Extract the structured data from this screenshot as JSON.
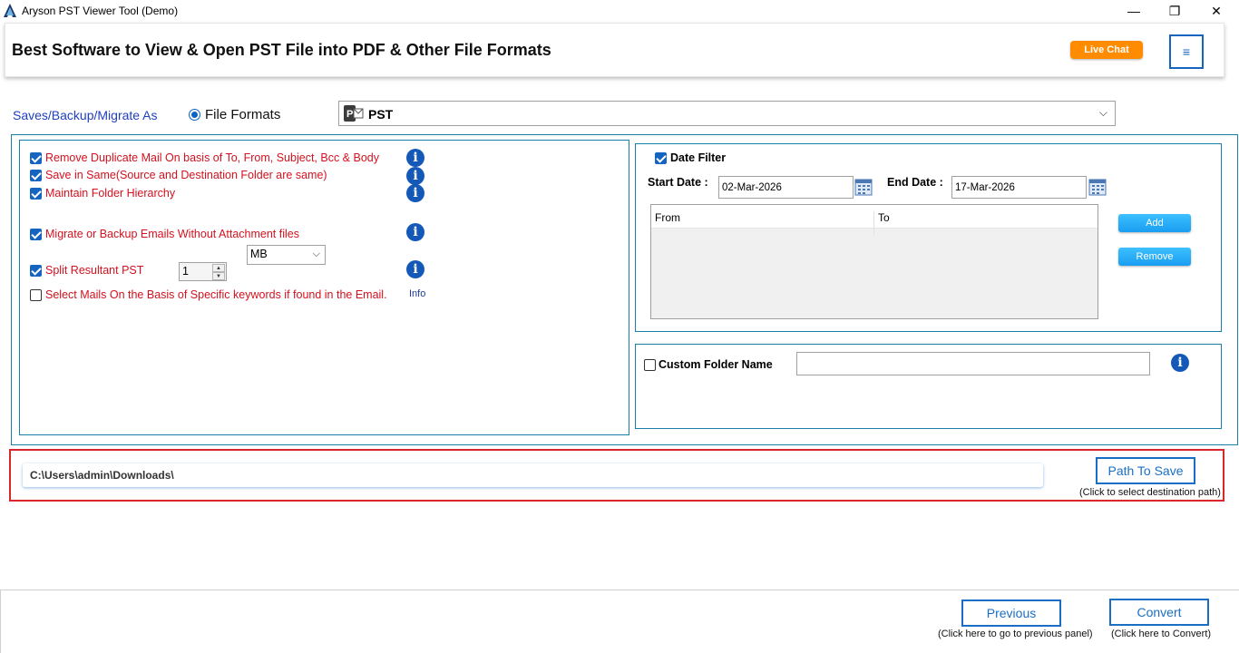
{
  "window": {
    "title": "Aryson PST Viewer Tool (Demo)",
    "controls": {
      "minimize": "—",
      "restore": "❐",
      "close": "✕"
    }
  },
  "header": {
    "title": "Best Software to View & Open PST File into PDF & Other File Formats",
    "live_chat": "Live Chat",
    "menu_icon": "≡"
  },
  "save_as": {
    "label": "Saves/Backup/Migrate As",
    "radio_label": "File Formats",
    "format_value": "PST"
  },
  "options": {
    "items": [
      {
        "label": "Remove Duplicate Mail On basis of To, From, Subject, Bcc & Body",
        "checked": true
      },
      {
        "label": "Save in Same(Source and Destination Folder are same)",
        "checked": true
      },
      {
        "label": "Maintain Folder Hierarchy",
        "checked": true
      },
      {
        "label": "Migrate or Backup Emails Without Attachment files",
        "checked": true
      },
      {
        "label": "Split Resultant PST",
        "checked": true
      },
      {
        "label": "Select Mails On the Basis of Specific keywords if found in the Email.",
        "checked": false
      }
    ],
    "split_value": "1",
    "split_unit": "MB",
    "info_link": "Info",
    "info_glyph": "i"
  },
  "date_filter": {
    "label": "Date Filter",
    "checked": true,
    "start_label": "Start Date :",
    "start_value": "02-Mar-2026",
    "end_label": "End Date :",
    "end_value": "17-Mar-2026",
    "columns": [
      "From",
      "To"
    ],
    "add_label": "Add",
    "remove_label": "Remove"
  },
  "custom_folder": {
    "label": "Custom Folder Name",
    "checked": false,
    "value": ""
  },
  "path": {
    "value": "C:\\Users\\admin\\Downloads\\",
    "button": "Path To Save",
    "hint": "(Click to select destination path)"
  },
  "footer": {
    "previous": "Previous",
    "previous_hint": "(Click here to go to previous panel)",
    "convert": "Convert",
    "convert_hint": "(Click here to Convert)"
  },
  "colors": {
    "accent": "#1a6fc4",
    "option_text": "#d4111e",
    "live_chat": "#ff8c00",
    "path_border": "#d8262c",
    "panel_border": "#1a7fa8"
  }
}
